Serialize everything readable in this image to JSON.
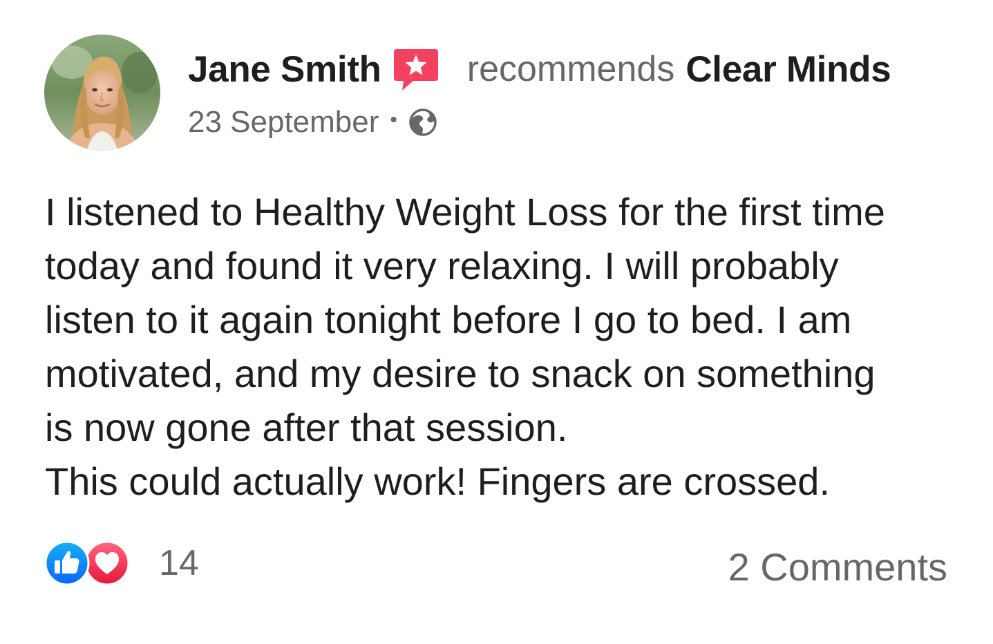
{
  "post": {
    "author": {
      "name": "Jane Smith",
      "avatar_icon": "person-avatar"
    },
    "action_text": "recommends",
    "page_name": "Clear Minds",
    "recommend_icon": "recommend-star-icon",
    "date": "23 September",
    "separator": "•",
    "audience_icon": "globe-icon",
    "body_lines": [
      "I listened to Healthy Weight Loss for the first time",
      "today and found it very relaxing. I will probably",
      "listen to it again tonight before I go to bed. I am",
      "motivated, and my desire to snack on something",
      "is now gone after that session.",
      "This could actually work! Fingers are crossed."
    ],
    "reactions": {
      "types": [
        "like-icon",
        "love-icon"
      ],
      "count": "14"
    },
    "comments_label": "2 Comments"
  },
  "colors": {
    "text_primary": "#1c1e21",
    "text_secondary": "#65676b",
    "recommend_red": "#f3425f",
    "like_blue": "#1877f2",
    "love_red": "#f33e58"
  }
}
